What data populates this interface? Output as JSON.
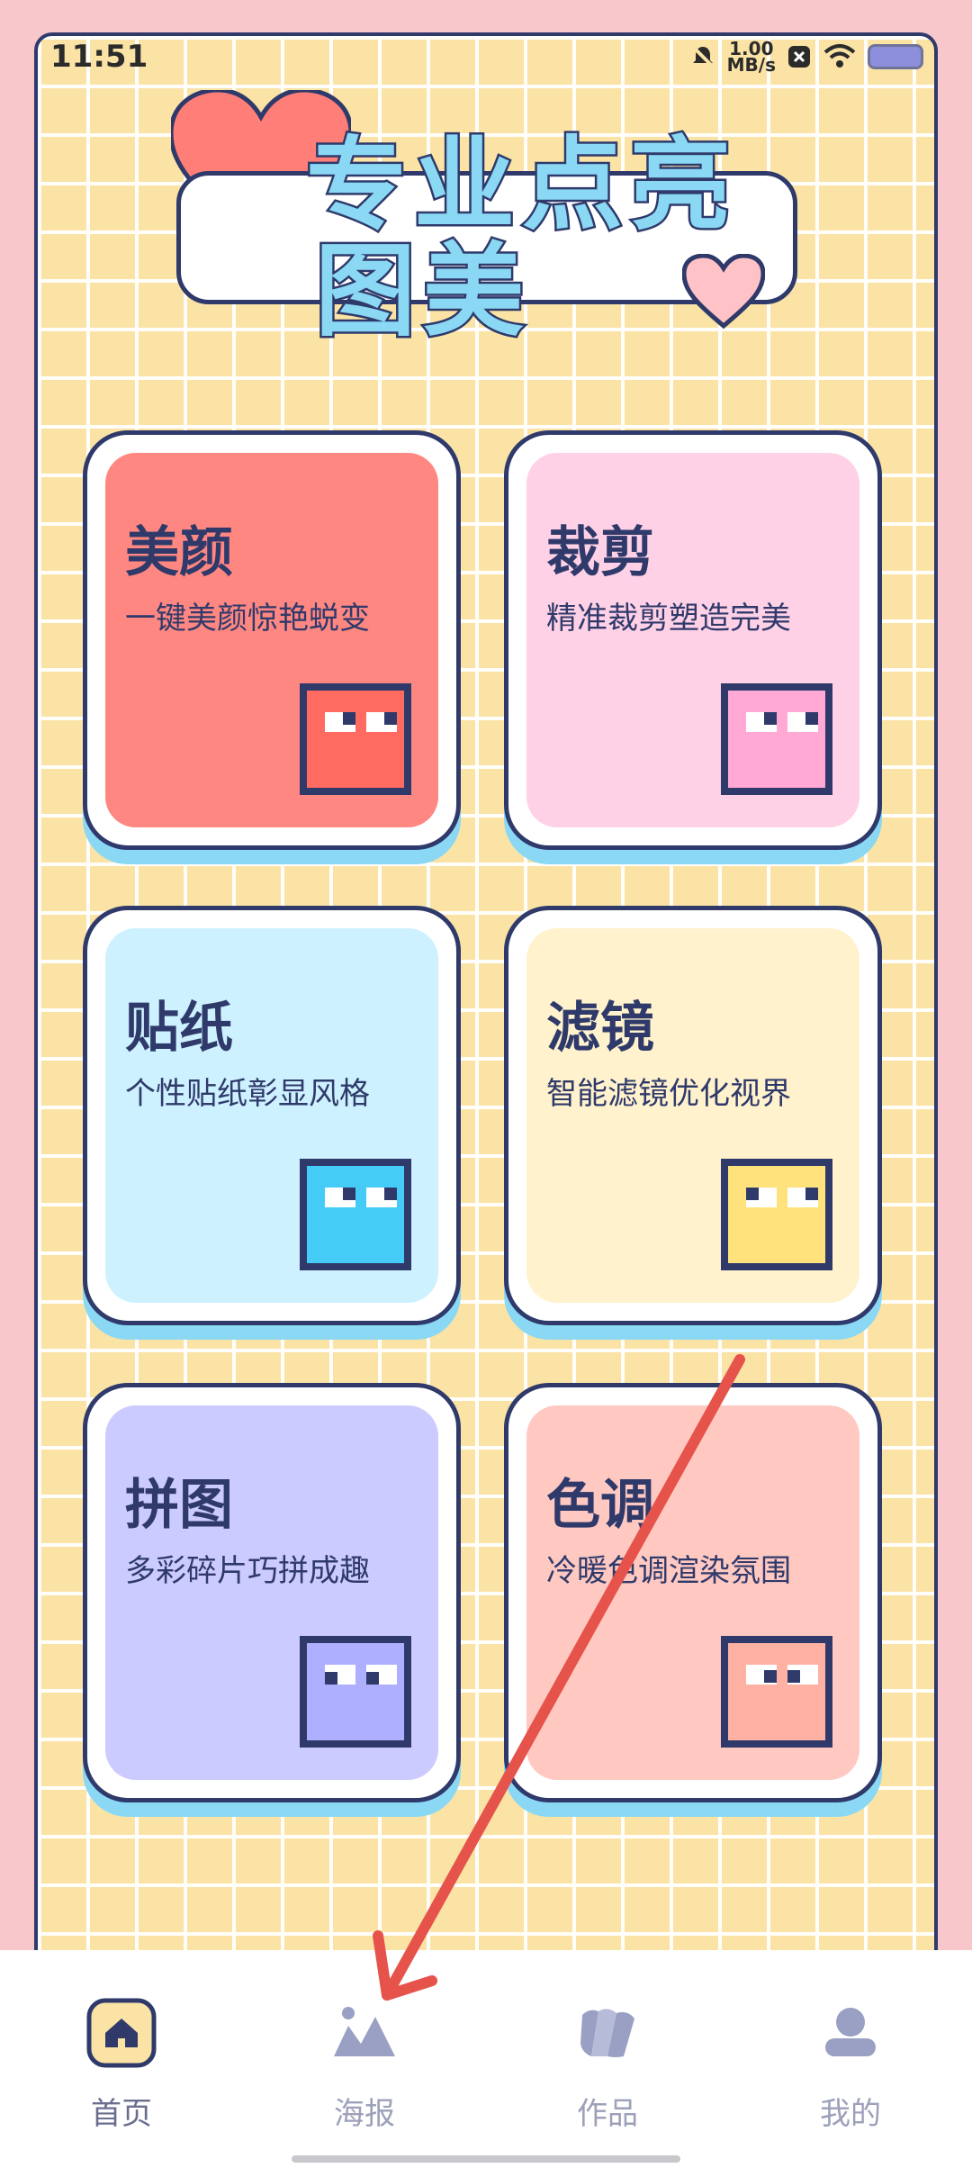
{
  "status_bar": {
    "time": "11:51",
    "net_speed_value": "1.00",
    "net_speed_unit": "MB/s",
    "icons": [
      "bell-muted-icon",
      "notification-x-icon",
      "wifi-icon",
      "battery-icon"
    ]
  },
  "banner": {
    "title_line1": "专业点亮",
    "title_line2": "图美"
  },
  "cards": [
    {
      "title": "美颜",
      "subtitle": "一键美颜惊艳蜕变",
      "color": "#ff8781",
      "pixel_color": "#ff6b61"
    },
    {
      "title": "裁剪",
      "subtitle": "精准裁剪塑造完美",
      "color": "#ffd1e6",
      "pixel_color": "#ffa9d4"
    },
    {
      "title": "贴纸",
      "subtitle": "个性贴纸彰显风格",
      "color": "#cdf1ff",
      "pixel_color": "#44ccf6"
    },
    {
      "title": "滤镜",
      "subtitle": "智能滤镜优化视界",
      "color": "#fff2cc",
      "pixel_color": "#ffe27b"
    },
    {
      "title": "拼图",
      "subtitle": "多彩碎片巧拼成趣",
      "color": "#cccbff",
      "pixel_color": "#aeb0ff"
    },
    {
      "title": "色调",
      "subtitle": "冷暖色调渲染氛围",
      "color": "#ffc9c2",
      "pixel_color": "#ffb1a4"
    }
  ],
  "tabbar": {
    "tabs": [
      {
        "label": "首页",
        "icon": "home-icon",
        "active": true
      },
      {
        "label": "海报",
        "icon": "poster-mountain-icon",
        "active": false
      },
      {
        "label": "作品",
        "icon": "works-stack-icon",
        "active": false
      },
      {
        "label": "我的",
        "icon": "profile-icon",
        "active": false
      }
    ]
  },
  "colors": {
    "outline": "#2f3a6b",
    "background_grid": "#fbe3a6",
    "page_bg": "#f8c7cc",
    "arrow": "#e5534b"
  }
}
